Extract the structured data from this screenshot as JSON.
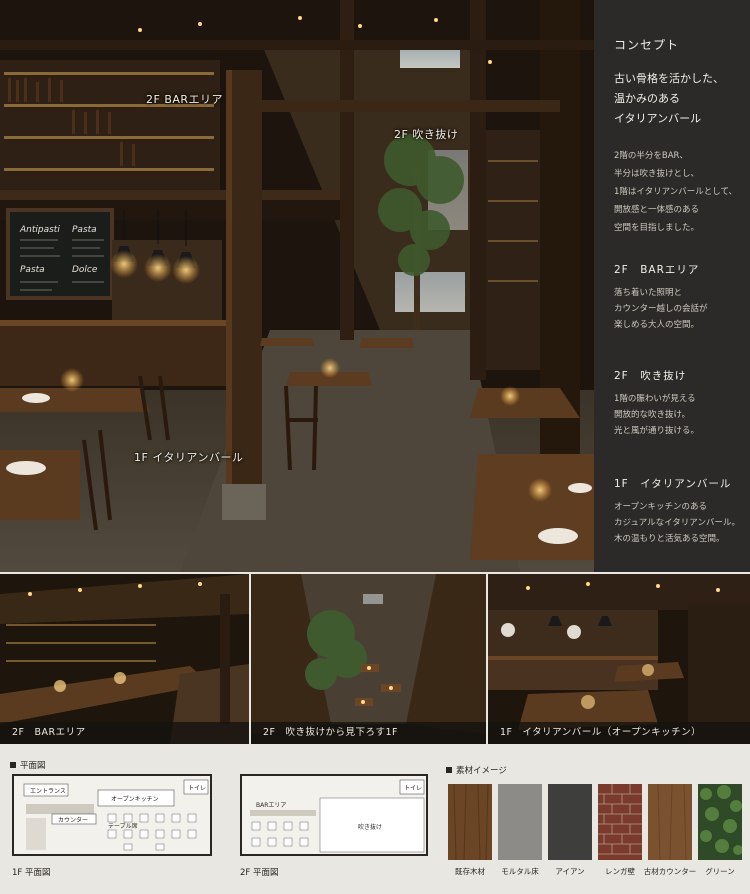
{
  "hero": {
    "labels": {
      "bar_2f": "2F BARエリア",
      "void_2f": "2F 吹き抜け",
      "italian_1f": "1F イタリアンバール"
    },
    "chalkboard": {
      "left_title": "Antipasti",
      "right_title": "Pasta",
      "left_sub": "Pasta",
      "right_sub": "Dolce"
    }
  },
  "concept": {
    "heading": "コンセプト",
    "tagline": "古い骨格を活かした、\n温かみのある\nイタリアンバール",
    "body": "2階の半分をBAR、\n半分は吹き抜けとし、\n1階はイタリアンバールとして、\n開放感と一体感のある\n空間を目指しました。",
    "sections": [
      {
        "title": "2F　BARエリア",
        "body": "落ち着いた照明と\nカウンター越しの会話が\n楽しめる大人の空間。"
      },
      {
        "title": "2F　吹き抜け",
        "body": "1階の賑わいが見える\n開放的な吹き抜け。\n光と風が通り抜ける。"
      },
      {
        "title": "1F　イタリアンバール",
        "body": "オープンキッチンのある\nカジュアルなイタリアンバール。\n木の温もりと活気ある空間。"
      }
    ]
  },
  "thumbnails": [
    {
      "caption": "2F　BARエリア"
    },
    {
      "caption": "2F　吹き抜けから見下ろす1F"
    },
    {
      "caption": "1F　イタリアンバール（オープンキッチン）"
    }
  ],
  "floor_plan": {
    "heading": "平面図",
    "plan_1f": {
      "caption": "1F 平面図",
      "entrance": "エントランス",
      "kitchen": "オープンキッチン",
      "toilet": "トイレ",
      "counter": "カウンター",
      "table": "テーブル席"
    },
    "plan_2f": {
      "caption": "2F 平面図",
      "bar": "BARエリア",
      "toilet": "トイレ",
      "void": "吹き抜け"
    }
  },
  "materials": {
    "heading": "素材イメージ",
    "items": [
      {
        "label": "既存木材",
        "color": "#6a4526"
      },
      {
        "label": "モルタル床",
        "color": "#8d8b87"
      },
      {
        "label": "アイアン",
        "color": "#3e3e3d"
      },
      {
        "label": "レンガ壁",
        "color": "#7a3a2c"
      },
      {
        "label": "古材カウンター",
        "color": "#7b5230"
      },
      {
        "label": "グリーン",
        "color": "#2f4a26"
      }
    ]
  }
}
